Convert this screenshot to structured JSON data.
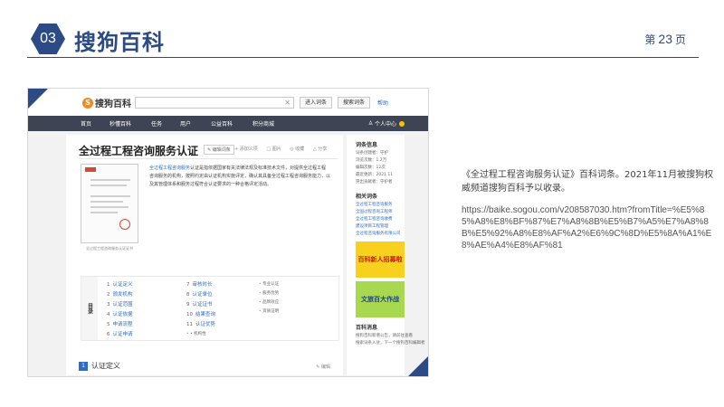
{
  "slide": {
    "number": "03",
    "title": "搜狗百科",
    "page_prefix": "第",
    "page_number": "23",
    "page_suffix": "页",
    "accent_color": "#2c4a86"
  },
  "browser": {
    "logo_text": "搜狗百科",
    "logo_icon": "sogou-s-icon",
    "search_placeholder": "",
    "enter_entry_label": "进入词条",
    "search_entry_label": "搜索词条",
    "help_label": "帮助",
    "nav": [
      "首页",
      "秒懂百科",
      "任务",
      "用户",
      "公益百科",
      "积分商城"
    ],
    "user_center": "个人中心",
    "article": {
      "title": "全过程工程咨询服务认证",
      "edit_label": "编辑词条",
      "tools": [
        "+ 添加义项",
        "□ 图片",
        "◎ 收藏",
        "△ 分享"
      ],
      "intro_link": "全过程工程咨询服务",
      "intro_text": "认证是指依据国家有关法律法规及标准技术文件，对提供全过程工程咨询服务的机构，按照约定由认证机构实施评定，确认其具备全过程工程咨询服务能力，以及其管理体系和服务过程符合认证要求的一种合格评定活动。",
      "cert_caption": "全过程工程咨询服务认证证书",
      "toc_tag": "目录",
      "toc_col1": [
        {
          "n": "1",
          "label": "认证定义"
        },
        {
          "n": "2",
          "label": "颁发机构"
        },
        {
          "n": "3",
          "label": "认证范围"
        },
        {
          "n": "4",
          "label": "认证依据"
        },
        {
          "n": "5",
          "label": "申请流程"
        },
        {
          "n": "6",
          "label": "认证申请"
        }
      ],
      "toc_col2": [
        {
          "n": "7",
          "label": "审核时长"
        },
        {
          "n": "8",
          "label": "认证单位"
        },
        {
          "n": "9",
          "label": "认证证书"
        },
        {
          "n": "10",
          "label": "结果查询"
        },
        {
          "n": "11",
          "label": "认证优势"
        },
        {
          "n": "",
          "label": "• 机构性"
        }
      ],
      "toc_col3": [
        "专业认证",
        "服务优势",
        "品牌效应",
        "资质证明"
      ],
      "section_no": "1",
      "section_title": "认证定义",
      "section_edit": "✎ 编辑"
    },
    "sidebar": {
      "info_heading": "词条信息",
      "info_rows": [
        "词条创建者：守护",
        "浏览次数：1.2万",
        "编辑次数：12次",
        "最近更新：2021.11",
        "突出贡献者：守护者"
      ],
      "related_heading": "相关词条",
      "related_links": [
        "全过程工程咨询服务",
        "全国过程咨询工程师",
        "全过程工程咨询收费",
        "建设项目工程管理",
        "全过程咨询服务有限公司"
      ],
      "banner1": "百科新人招募啦",
      "banner2": "文旅百大作战",
      "tips_heading": "百科消息",
      "tips_rows": [
        "搜狗百科新增公告，请前往查看",
        "搜索词条入驻，下一个搜狗百科编辑者"
      ]
    }
  },
  "description": {
    "text": "《全过程工程咨询服务认证》百科词条。2021年11月被搜狗权威频道搜狗百科予以收录。",
    "url": "https://baike.sogou.com/v208587030.htm?fromTitle=%E5%85%A8%E8%BF%87%E7%A8%8B%E5%B7%A5%E7%A8%8B%E5%92%A8%E8%AF%A2%E6%9C%8D%E5%8A%A1%E8%AE%A4%E8%AF%81"
  }
}
